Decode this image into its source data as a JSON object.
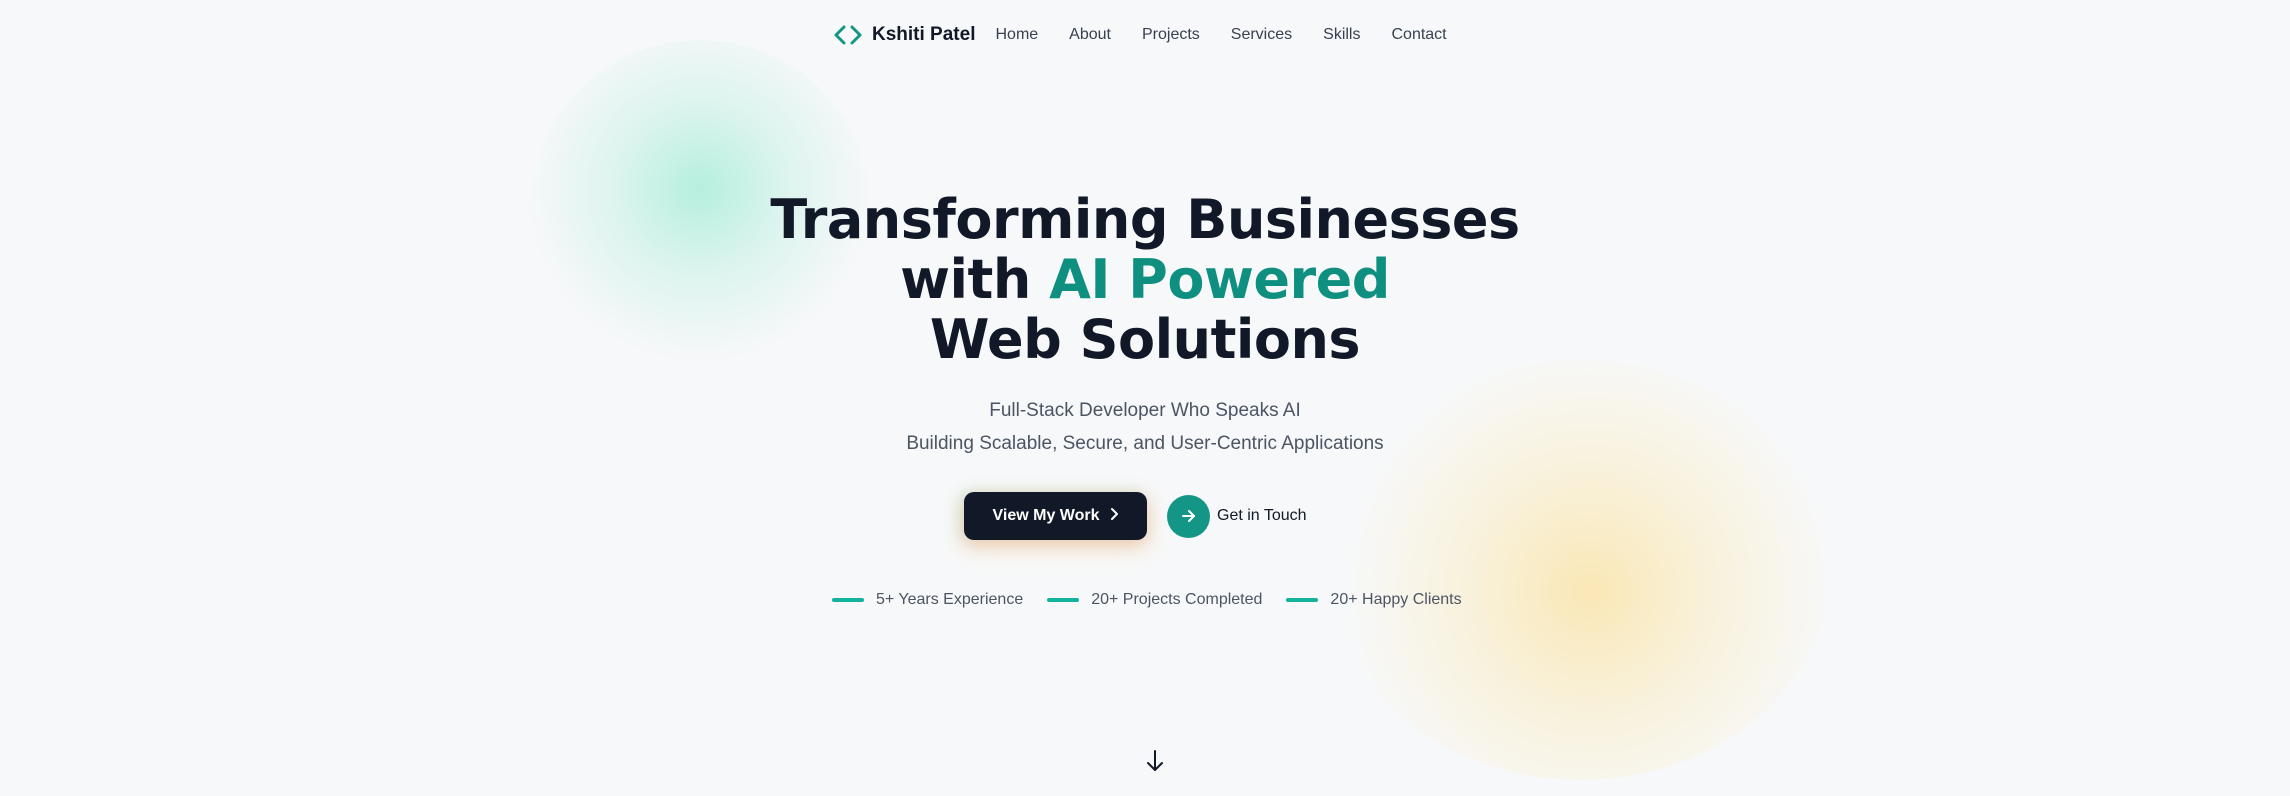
{
  "brand": {
    "name": "Kshiti Patel",
    "icon": "code-brackets-icon"
  },
  "nav": {
    "links": [
      "Home",
      "About",
      "Projects",
      "Services",
      "Skills",
      "Contact"
    ]
  },
  "hero": {
    "title_line1": "Transforming Businesses",
    "title_line2_prefix": "with",
    "title_line2_accent": "AI Powered",
    "title_line3": "Web Solutions",
    "subtitle_line1": "Full-Stack Developer Who Speaks AI",
    "subtitle_line2": "Building Scalable, Secure, and User-Centric Applications"
  },
  "cta": {
    "primary_label": "View My Work",
    "primary_icon": "chevron-right-icon",
    "secondary_label": "Get in Touch",
    "secondary_icon": "arrow-right-icon"
  },
  "stats": [
    {
      "label": "5+ Years Experience"
    },
    {
      "label": "20+ Projects Completed"
    },
    {
      "label": "20+ Happy Clients"
    }
  ],
  "scroll_icon": "arrow-down-icon",
  "colors": {
    "accent": "#0f8f80",
    "accent_button": "#149687",
    "dark": "#111827",
    "background": "#f7f8f9"
  }
}
